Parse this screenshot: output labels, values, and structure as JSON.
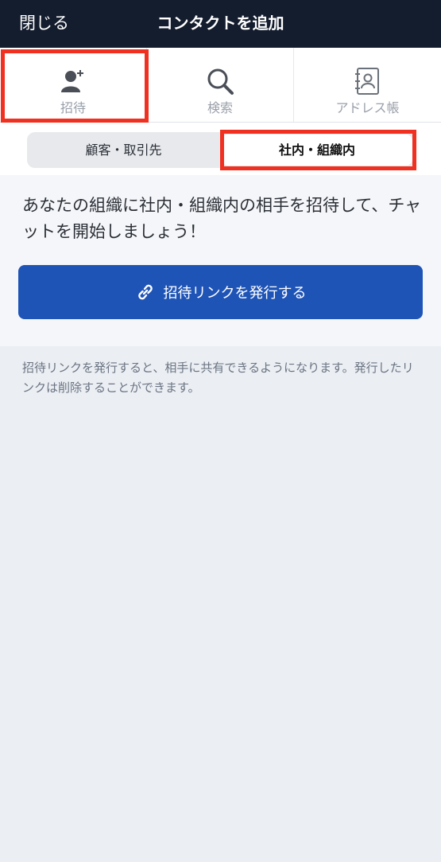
{
  "header": {
    "close_label": "閉じる",
    "title": "コンタクトを追加"
  },
  "tabs": [
    {
      "label": "招待",
      "icon": "add-person-icon"
    },
    {
      "label": "検索",
      "icon": "search-icon"
    },
    {
      "label": "アドレス帳",
      "icon": "address-book-icon"
    }
  ],
  "segment": {
    "left_label": "顧客・取引先",
    "right_label": "社内・組織内",
    "selected": "社内・組織内"
  },
  "main": {
    "intro_text": "あなたの組織に社内・組織内の相手を招待して、チャットを開始しましょう！",
    "issue_button_label": "招待リンクを発行する",
    "note_text": "招待リンクを発行すると、相手に共有できるようになります。発行したリンクは削除することができます。"
  },
  "colors": {
    "header_bg": "#141d2e",
    "primary_button": "#1f54b7",
    "highlight": "#f03121",
    "page_bg": "#ebeef3"
  }
}
